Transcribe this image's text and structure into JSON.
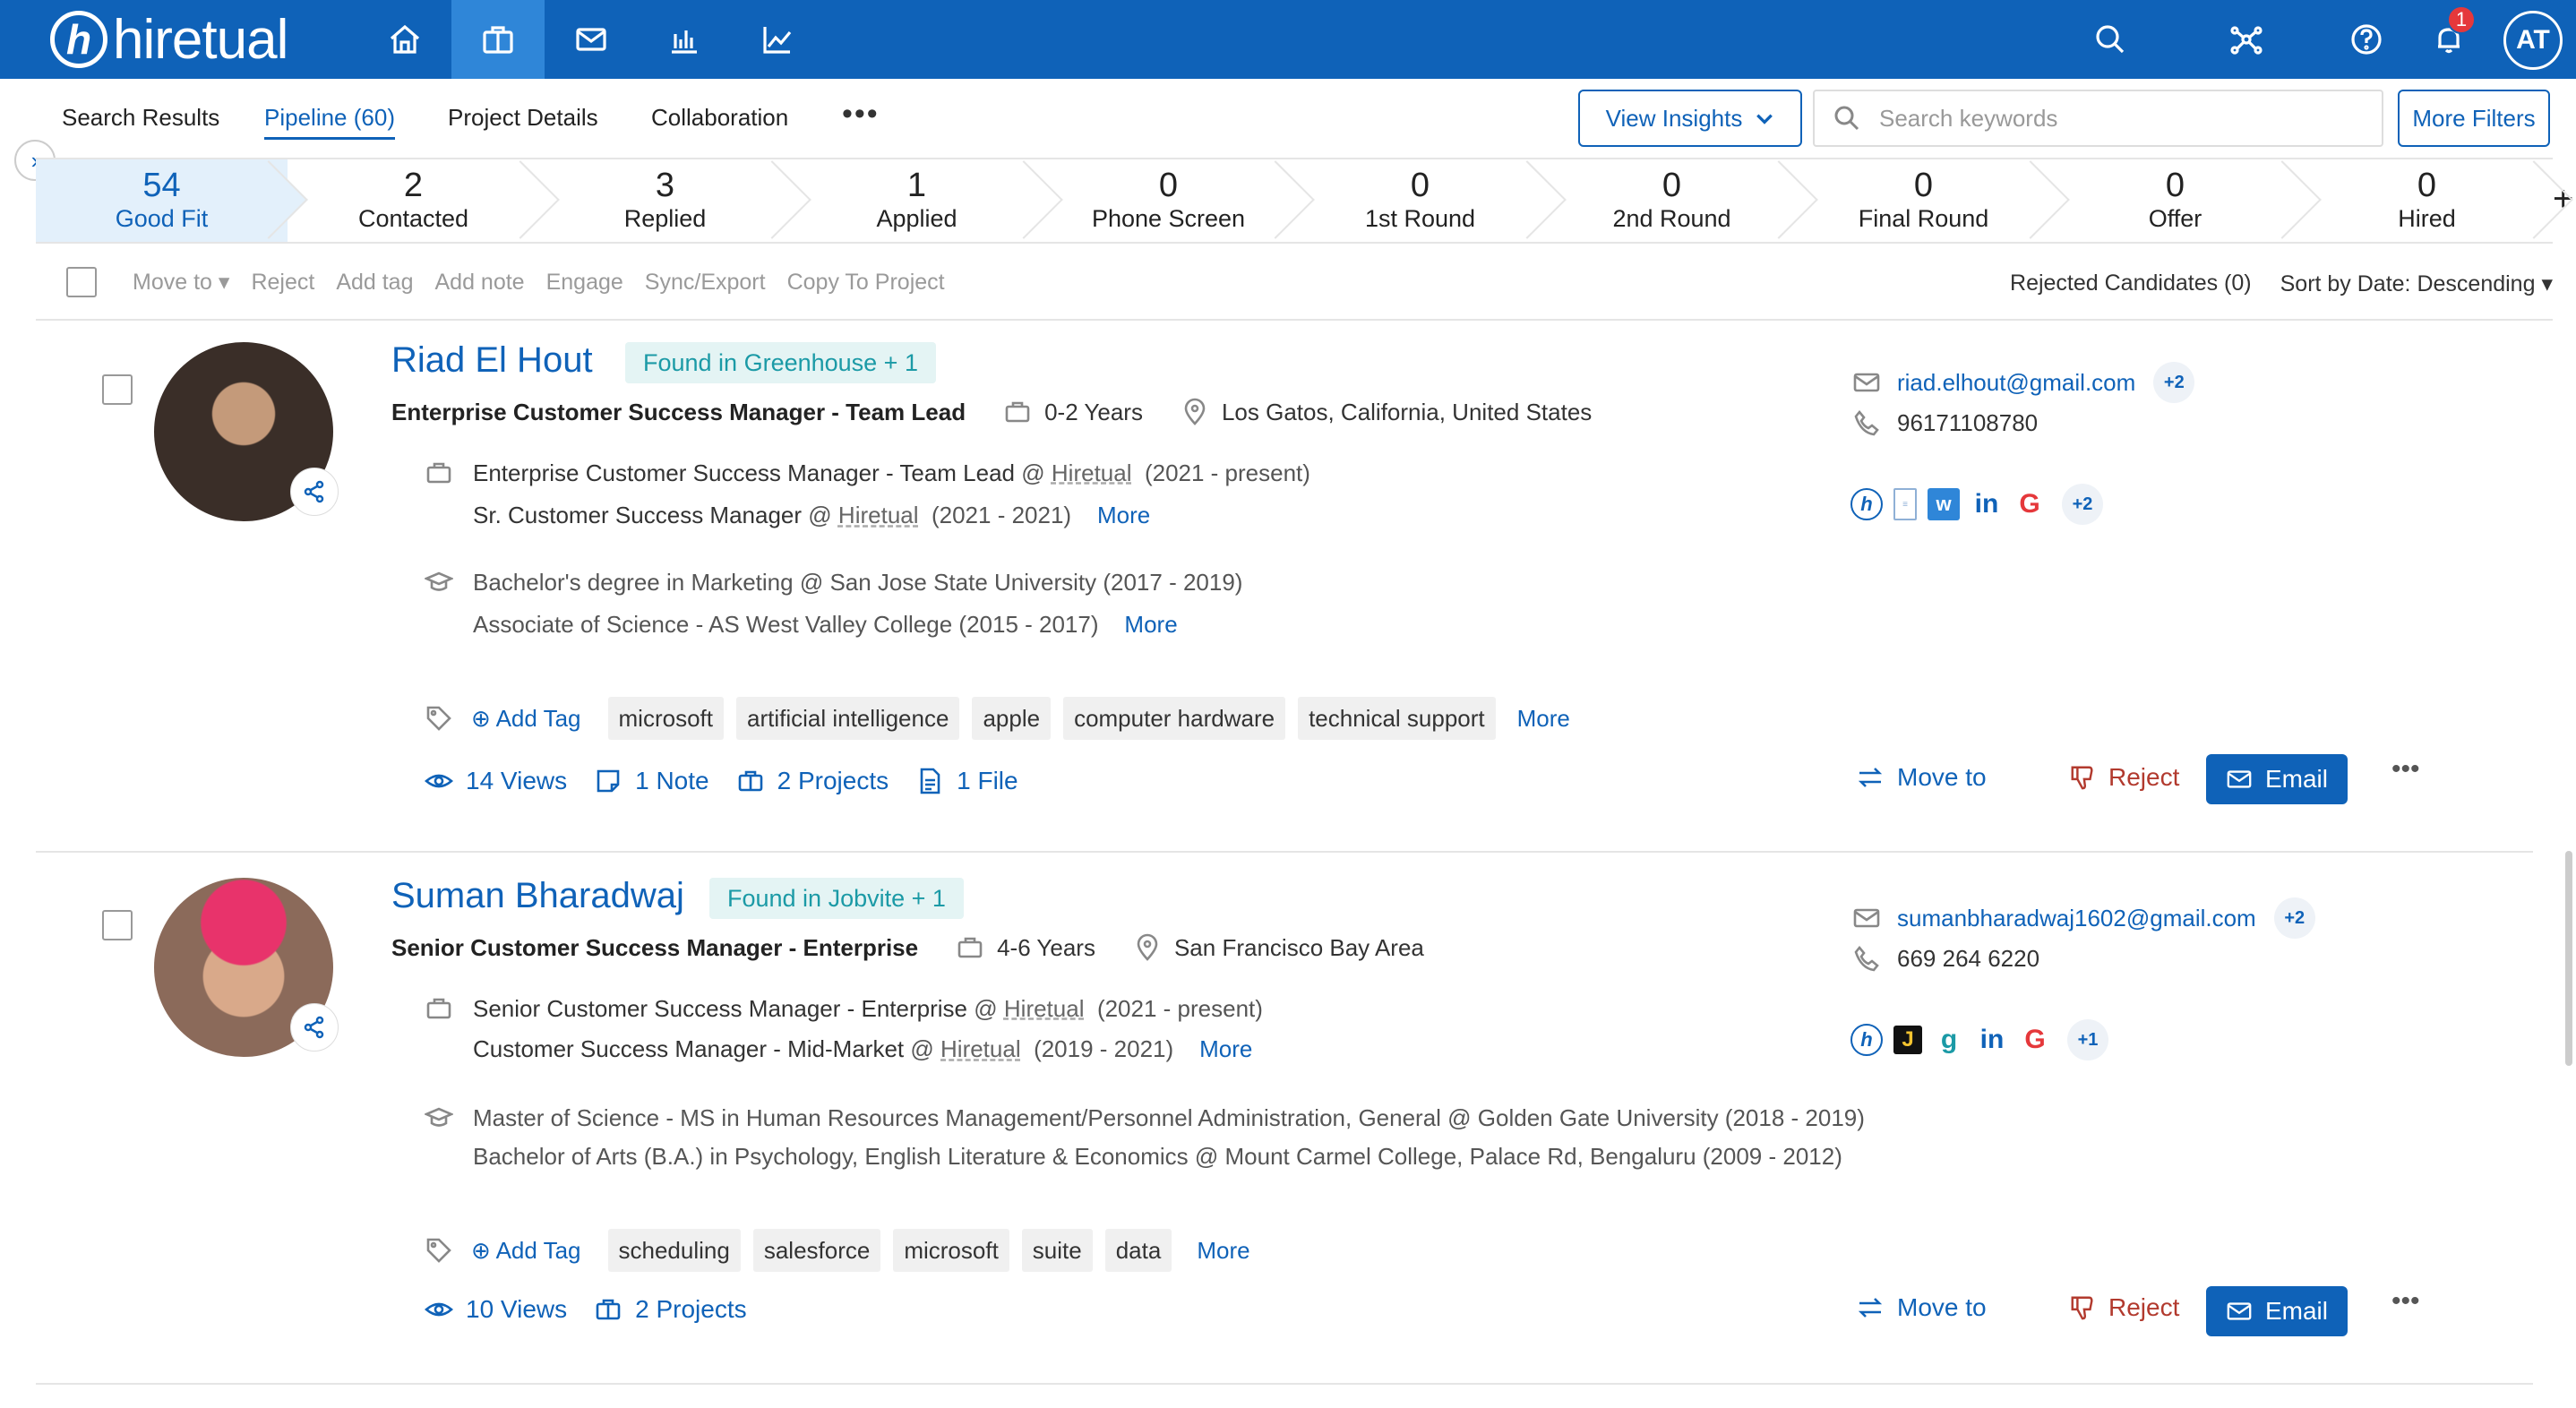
{
  "brand": {
    "name": "hiretual",
    "mark": "h"
  },
  "user": {
    "initials": "AT",
    "notifications": "1"
  },
  "colors": {
    "brand": "#0f62b8",
    "active_nav": "#2f86d8",
    "tag_found": "#1b9aa6",
    "reject": "#b23a2e"
  },
  "nav_icons": [
    "home-icon",
    "briefcase-icon",
    "mail-icon",
    "bar-chart-icon",
    "trend-icon"
  ],
  "tabs": [
    {
      "label": "Search Results"
    },
    {
      "label": "Pipeline (60)"
    },
    {
      "label": "Project Details"
    },
    {
      "label": "Collaboration"
    }
  ],
  "header": {
    "view_insights": "View Insights",
    "search_placeholder": "Search keywords",
    "more_filters": "More Filters"
  },
  "stages": [
    {
      "count": "54",
      "label": "Good Fit"
    },
    {
      "count": "2",
      "label": "Contacted"
    },
    {
      "count": "3",
      "label": "Replied"
    },
    {
      "count": "1",
      "label": "Applied"
    },
    {
      "count": "0",
      "label": "Phone Screen"
    },
    {
      "count": "0",
      "label": "1st Round"
    },
    {
      "count": "0",
      "label": "2nd Round"
    },
    {
      "count": "0",
      "label": "Final Round"
    },
    {
      "count": "0",
      "label": "Offer"
    },
    {
      "count": "0",
      "label": "Hired"
    }
  ],
  "toolbar": {
    "move_to": "Move to",
    "reject": "Reject",
    "add_tag": "Add tag",
    "add_note": "Add note",
    "engage": "Engage",
    "sync_export": "Sync/Export",
    "copy_to_project": "Copy To Project",
    "rejected_candidates": "Rejected Candidates (0)",
    "sort": "Sort by Date: Descending"
  },
  "candidates": [
    {
      "name": "Riad El Hout",
      "found": "Found in Greenhouse + 1",
      "title": "Enterprise Customer Success Manager - Team Lead",
      "experience": "0-2 Years",
      "location": "Los Gatos, California, United States",
      "jobs": [
        {
          "role": "Enterprise Customer Success Manager - Team Lead",
          "at": "@",
          "company": "Hiretual",
          "period": "(2021 - present)"
        },
        {
          "role": "Sr. Customer Success Manager",
          "at": "@",
          "company": "Hiretual",
          "period": "(2021 - 2021)"
        }
      ],
      "education": [
        "Bachelor's degree in Marketing @ San Jose State University (2017 - 2019)",
        "Associate of Science - AS West Valley College (2015 - 2017)"
      ],
      "add_tag": "Add Tag",
      "tags": [
        "microsoft",
        "artificial intelligence",
        "apple",
        "computer hardware",
        "technical support"
      ],
      "more": "More",
      "stats": [
        {
          "icon": "eye-icon",
          "label": "14 Views"
        },
        {
          "icon": "note-icon",
          "label": "1 Note"
        },
        {
          "icon": "briefcase-icon",
          "label": "2 Projects"
        },
        {
          "icon": "file-icon",
          "label": "1 File"
        }
      ],
      "email": "riad.elhout@gmail.com",
      "email_extra": "+2",
      "phone": "96171108780",
      "social_extra": "+2",
      "move_to": "Move to",
      "reject": "Reject",
      "email_btn": "Email"
    },
    {
      "name": "Suman Bharadwaj",
      "found": "Found in Jobvite + 1",
      "title": "Senior Customer Success Manager - Enterprise",
      "experience": "4-6 Years",
      "location": "San Francisco Bay Area",
      "jobs": [
        {
          "role": "Senior Customer Success Manager - Enterprise",
          "at": "@",
          "company": "Hiretual",
          "period": "(2021 - present)"
        },
        {
          "role": "Customer Success Manager - Mid-Market",
          "at": "@",
          "company": "Hiretual",
          "period": "(2019 - 2021)"
        }
      ],
      "education": [
        "Master of Science - MS in Human Resources Management/Personnel Administration, General @ Golden Gate University (2018 - 2019)",
        "Bachelor of Arts (B.A.) in Psychology, English Literature & Economics @ Mount Carmel College, Palace Rd, Bengaluru (2009 - 2012)"
      ],
      "add_tag": "Add Tag",
      "tags": [
        "scheduling",
        "salesforce",
        "microsoft",
        "suite",
        "data"
      ],
      "more": "More",
      "stats": [
        {
          "icon": "eye-icon",
          "label": "10 Views"
        },
        {
          "icon": "briefcase-icon",
          "label": "2 Projects"
        }
      ],
      "email": "sumanbharadwaj1602@gmail.com",
      "email_extra": "+2",
      "phone": "669 264 6220",
      "social_extra": "+1",
      "move_to": "Move to",
      "reject": "Reject",
      "email_btn": "Email"
    }
  ]
}
